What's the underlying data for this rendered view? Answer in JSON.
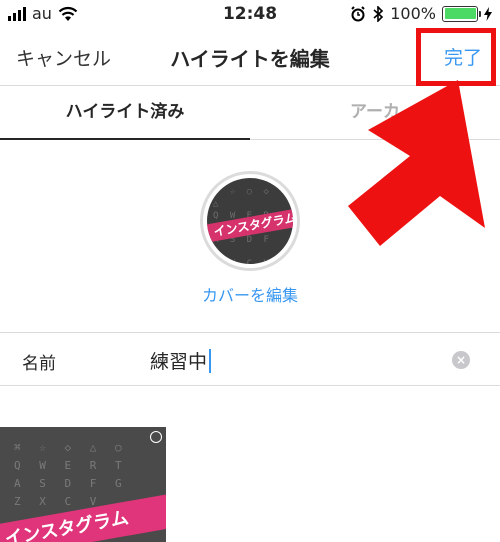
{
  "status_bar": {
    "carrier": "au",
    "time": "12:48",
    "battery_text": "100%",
    "battery_level": 1.0,
    "icons": [
      "signal-icon",
      "wifi-icon",
      "alarm-icon",
      "bluetooth-icon",
      "charging-icon",
      "battery-icon"
    ]
  },
  "nav": {
    "cancel_label": "キャンセル",
    "title": "ハイライトを編集",
    "done_label": "完了"
  },
  "tabs": [
    {
      "label": "ハイライト済み",
      "active": true
    },
    {
      "label": "アーカ",
      "active": false
    }
  ],
  "cover": {
    "banner_text": "インスタグラム",
    "edit_label": "カバーを編集"
  },
  "name_field": {
    "label": "名前",
    "value": "練習中"
  },
  "story_thumb": {
    "banner_text": "インスタグラム"
  },
  "colors": {
    "accent": "#3897f0",
    "annotation": "#ee1111",
    "banner": "#e0357a"
  }
}
